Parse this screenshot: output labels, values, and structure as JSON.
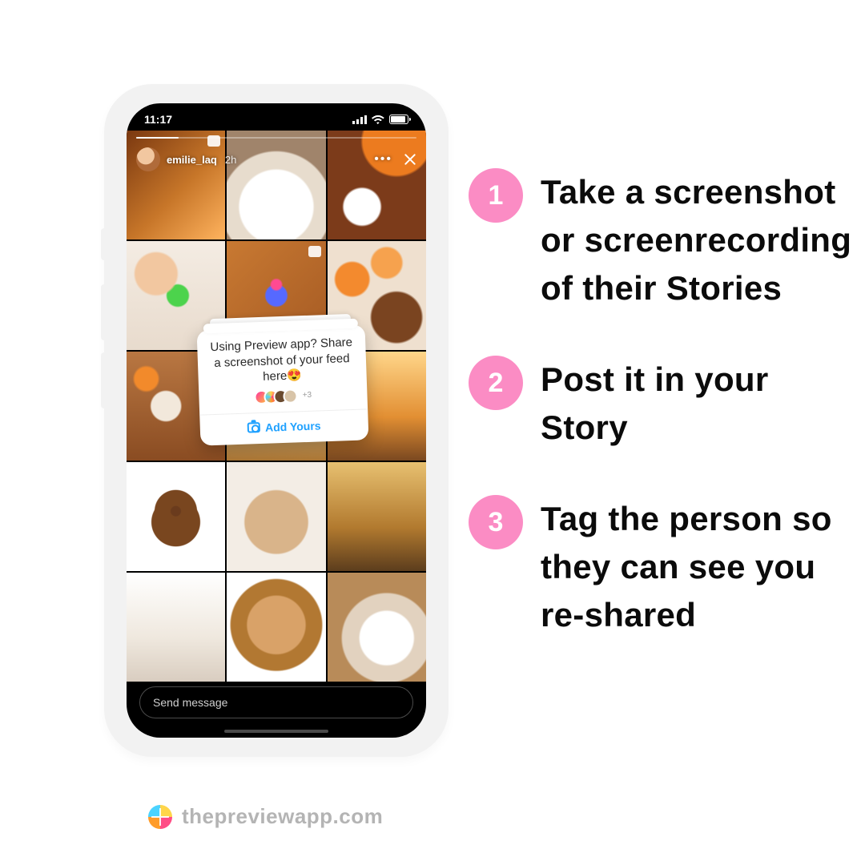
{
  "phone": {
    "status_time": "11:17",
    "story": {
      "username": "emilie_laq",
      "age": "2h",
      "reply_placeholder": "Send message"
    },
    "sticker": {
      "prompt": "Using Preview app? Share a screenshot of your feed here",
      "emoji": "😍",
      "more_count": "+3",
      "cta": "Add Yours"
    }
  },
  "steps": [
    {
      "n": "1",
      "text": "Take a screenshot or screenrecording of their Stories"
    },
    {
      "n": "2",
      "text": "Post it in your Story"
    },
    {
      "n": "3",
      "text": "Tag the person so they can see you re-shared"
    }
  ],
  "watermark": "thepreviewapp.com"
}
